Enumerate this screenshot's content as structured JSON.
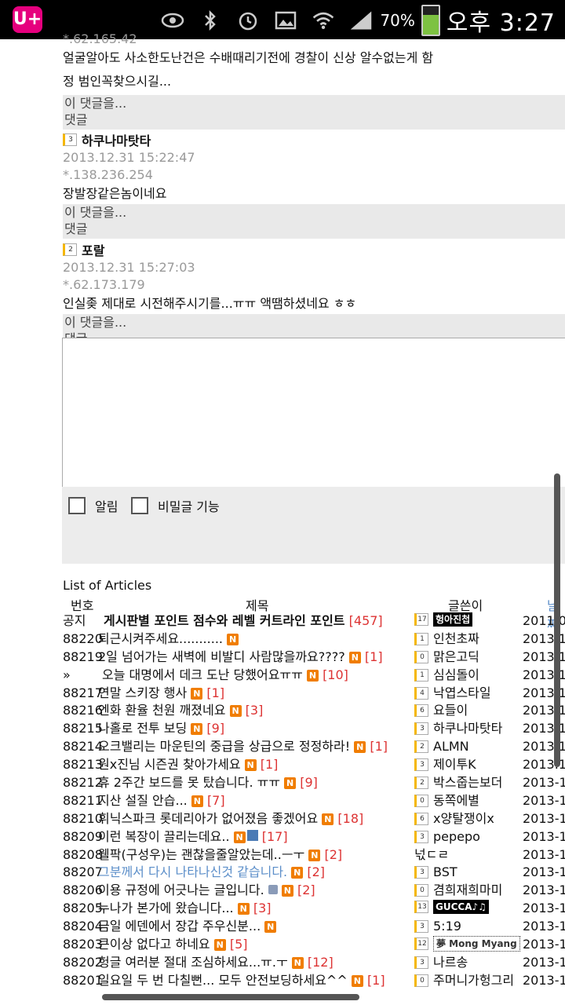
{
  "status": {
    "carrier_logo": "U+",
    "icons": [
      "eye-icon",
      "bluetooth-icon",
      "alarm-icon",
      "gallery-icon",
      "wifi-icon",
      "signal-icon"
    ],
    "battery": "70%",
    "time": "오후 3:27"
  },
  "comments_top": {
    "ip_partial": "*.62.165.42",
    "text1": "얼굴알아도 사소한도난건은 수배때리기전에 경찰이 신상 알수없는게 함",
    "text2": "정 범인꼭찾으시길..."
  },
  "reply": {
    "line1": "이 댓글을...",
    "line2": "댓글"
  },
  "comments": [
    {
      "level": "3",
      "author": "하쿠나마탓타",
      "date": "2013.12.31 15:22:47",
      "ip": "*.138.236.254",
      "text": "장발장같은놈이네요"
    },
    {
      "level": "2",
      "author": "포랄",
      "date": "2013.12.31 15:27:03",
      "ip": "*.62.173.179",
      "text": "인실좆 제대로 시전해주시기를...ㅠㅠ 액땜하셨네요 ㅎㅎ"
    }
  ],
  "options": {
    "notify": "알림",
    "secret": "비밀글 기능"
  },
  "list": {
    "title": "List of Articles",
    "col_no": "번호",
    "col_title": "제목",
    "col_author": "글쓴이",
    "col_date": "날짜"
  },
  "rows": [
    {
      "no": "공지",
      "title": "게시판별 포인트 점수와 레벨 커트라인 포인트",
      "count": "[457]",
      "level": "17",
      "author": "헝아진첩",
      "author_img": true,
      "date": "2011.0"
    },
    {
      "no": "88220",
      "title": "퇴근시켜주세요...........",
      "count": "",
      "level": "1",
      "author": "인천초짜",
      "date": "2013.1"
    },
    {
      "no": "88219",
      "title": "2일 넘어가는 새벽에 비발디 사람많을까요????",
      "count": "[1]",
      "level": "0",
      "author": "맑은고딕",
      "date": "2013.1"
    },
    {
      "no": "»",
      "title": "오늘 대명에서 데크 도난 당했어요ㅠㅠ",
      "count": "[10]",
      "level": "1",
      "author": "심심돌이",
      "date": "2013.1"
    },
    {
      "no": "88217",
      "title": "연말 스키장 행사",
      "count": "[1]",
      "level": "4",
      "author": "낙엽스타일",
      "date": "2013.1"
    },
    {
      "no": "88216",
      "title": "엔화 환율 천원 깨졌네요",
      "count": "[3]",
      "level": "6",
      "author": "요들이",
      "date": "2013.1"
    },
    {
      "no": "88215",
      "title": "나홀로 전투 보딩",
      "count": "[9]",
      "level": "3",
      "author": "하쿠나마탓타",
      "date": "2013.1"
    },
    {
      "no": "88214",
      "title": "오크밸리는 마운틴의 중급을 상급으로 정정하라!",
      "count": "[1]",
      "level": "2",
      "author": "ALMN",
      "date": "2013.1"
    },
    {
      "no": "88213",
      "title": "원x진님 시즌권 찾아가세요",
      "count": "[1]",
      "level": "3",
      "author": "제이투K",
      "date": "2013.1"
    },
    {
      "no": "88212",
      "title": "휴 2주간 보드를 못 탔습니다. ㅠㅠ",
      "count": "[9]",
      "level": "2",
      "author": "박스줍는보더",
      "date": "2013-1"
    },
    {
      "no": "88211",
      "title": "지산 설질 안습...",
      "count": "[7]",
      "level": "0",
      "author": "동쪽에별",
      "date": "2013-1"
    },
    {
      "no": "88210",
      "title": "휘닉스파크 롯데리아가 없어졌음 좋겠어요",
      "count": "[18]",
      "level": "6",
      "author": "x양탈쟁이x",
      "date": "2013-1"
    },
    {
      "no": "88209",
      "title": "이런 복장이 끌리는데요..",
      "count": "[17]",
      "level": "3",
      "author": "pepepo",
      "date": "2013-1",
      "save_icon": true
    },
    {
      "no": "88208",
      "title": "웰팍(구성우)는 괜찮을줄알았는데..ㅡㅜ",
      "count": "[2]",
      "level": "",
      "author": "넋ㄷㄹ",
      "date": "2013-1"
    },
    {
      "no": "88207",
      "title": "그분께서 다시 나타나신것 같습니다.",
      "count": "[2]",
      "level": "3",
      "author": "BST",
      "date": "2013-1",
      "blue": true
    },
    {
      "no": "88206",
      "title": "이용 규정에 어긋나는 글입니다.",
      "count": "[2]",
      "level": "0",
      "author": "겸희재희마미",
      "date": "2013-1",
      "lock_icon": true
    },
    {
      "no": "88205",
      "title": "누나가 본가에 왔습니다...",
      "count": "[3]",
      "level": "13",
      "author": "GUCCA♪♫",
      "author_img": true,
      "date": "2013-1"
    },
    {
      "no": "88204",
      "title": "금일 에덴에서 장갑 주우신분...",
      "count": "",
      "level": "3",
      "author": "5:19",
      "date": "2013-1"
    },
    {
      "no": "88203",
      "title": "큰이상 없다고 하네요",
      "count": "[5]",
      "level": "12",
      "author": "夢 Mong Myang",
      "author_img": true,
      "date": "2013-1"
    },
    {
      "no": "88202",
      "title": "헝글 여러분 절대 조심하세요...ㅠ.ㅜ",
      "count": "[12]",
      "level": "3",
      "author": "나르송",
      "date": "2013-1"
    },
    {
      "no": "88201",
      "title": "일요일 두 번 다칠뻔... 모두 안전보딩하세요^^",
      "count": "[1]",
      "level": "0",
      "author": "주머니가헝그리",
      "date": "2013-1"
    }
  ],
  "new_badge": "N"
}
